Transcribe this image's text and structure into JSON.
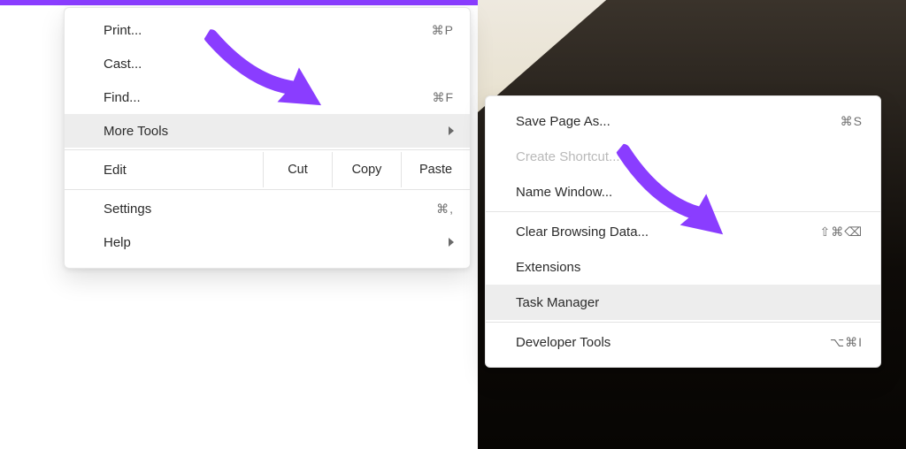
{
  "colors": {
    "accent": "#8a3dff"
  },
  "mainMenu": {
    "print": {
      "label": "Print...",
      "shortcut": "⌘P"
    },
    "cast": {
      "label": "Cast..."
    },
    "find": {
      "label": "Find...",
      "shortcut": "⌘F"
    },
    "moreTools": {
      "label": "More Tools"
    },
    "edit": {
      "label": "Edit",
      "cut": "Cut",
      "copy": "Copy",
      "paste": "Paste"
    },
    "settings": {
      "label": "Settings",
      "shortcut": "⌘,"
    },
    "help": {
      "label": "Help"
    }
  },
  "subMenu": {
    "savePageAs": {
      "label": "Save Page As...",
      "shortcut": "⌘S"
    },
    "createShortcut": {
      "label": "Create Shortcut..."
    },
    "nameWindow": {
      "label": "Name Window..."
    },
    "clearBrowsing": {
      "label": "Clear Browsing Data...",
      "shortcut": "⇧⌘⌫"
    },
    "extensions": {
      "label": "Extensions"
    },
    "taskManager": {
      "label": "Task Manager"
    },
    "devTools": {
      "label": "Developer Tools",
      "shortcut": "⌥⌘I"
    }
  }
}
